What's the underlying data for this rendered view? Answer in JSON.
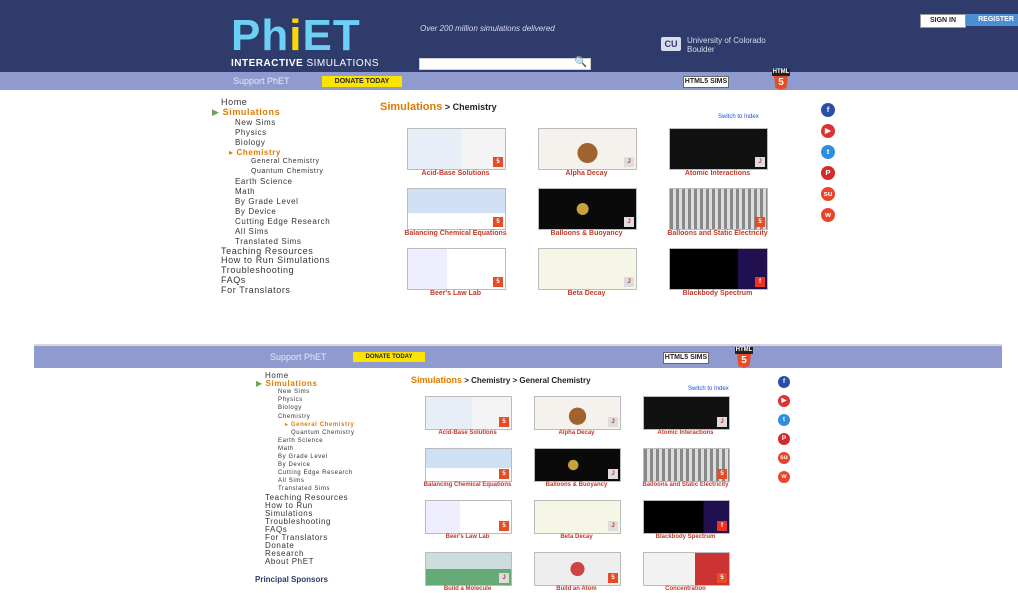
{
  "header": {
    "logo_main": [
      "Ph",
      "i",
      "ET"
    ],
    "logo_sub_bold": "INTERACTIVE",
    "logo_sub": " SIMULATIONS",
    "tagline": "Over 200 million simulations delivered",
    "university_line1": "University of Colorado",
    "university_line2": "Boulder",
    "university_mark": "CU",
    "signin": "SIGN IN",
    "register": "REGISTER",
    "search_icon": "search-icon",
    "search_glyph": "🔍"
  },
  "support_bar": {
    "support_text": "Support PhET",
    "donate": "DONATE TODAY",
    "html5_sims": "HTML5 SIMS",
    "html5_label": "HTML",
    "html5_glyph": "5"
  },
  "colors": {
    "header": "#2e3b6b",
    "support_bar": "#8f9bcf",
    "accent_orange": "#e07b00",
    "title_red": "#c0392b",
    "donate_yellow": "#fce300"
  },
  "top": {
    "nav": [
      {
        "label": "Home",
        "level": 0
      },
      {
        "label": "Simulations",
        "level": 0,
        "state": "active-arrow"
      },
      {
        "label": "New Sims",
        "level": 1
      },
      {
        "label": "Physics",
        "level": 1
      },
      {
        "label": "Biology",
        "level": 1
      },
      {
        "label": "Chemistry",
        "level": 1,
        "state": "active-bullet"
      },
      {
        "label": "General Chemistry",
        "level": 2
      },
      {
        "label": "Quantum Chemistry",
        "level": 2
      },
      {
        "label": "Earth Science",
        "level": 1
      },
      {
        "label": "Math",
        "level": 1
      },
      {
        "label": "By Grade Level",
        "level": 1
      },
      {
        "label": "By Device",
        "level": 1
      },
      {
        "label": "Cutting Edge Research",
        "level": 1
      },
      {
        "label": "All Sims",
        "level": 1
      },
      {
        "label": "Translated Sims",
        "level": 1
      },
      {
        "label": "Teaching Resources",
        "level": 0
      },
      {
        "label": "How to Run Simulations",
        "level": 0
      },
      {
        "label": "Troubleshooting",
        "level": 0
      },
      {
        "label": "FAQs",
        "level": 0
      },
      {
        "label": "For Translators",
        "level": 0
      }
    ],
    "breadcrumb": {
      "root": "Simulations",
      "sep": " > ",
      "leaf": "Chemistry"
    },
    "switch_link": "Switch to Index",
    "sims": [
      {
        "title": "Acid-Base Solutions",
        "badge": "html5"
      },
      {
        "title": "Alpha Decay",
        "badge": "java"
      },
      {
        "title": "Atomic Interactions",
        "badge": "java"
      },
      {
        "title": "Balancing Chemical Equations",
        "badge": "html5"
      },
      {
        "title": "Balloons & Buoyancy",
        "badge": "java"
      },
      {
        "title": "Balloons and Static Electricity",
        "badge": "html5"
      },
      {
        "title": "Beer's Law Lab",
        "badge": "html5"
      },
      {
        "title": "Beta Decay",
        "badge": "java"
      },
      {
        "title": "Blackbody Spectrum",
        "badge": "flash"
      }
    ]
  },
  "bottom": {
    "nav": [
      {
        "label": "Home",
        "level": 0
      },
      {
        "label": "Simulations",
        "level": 0,
        "state": "active-arrow"
      },
      {
        "label": "New Sims",
        "level": 1
      },
      {
        "label": "Physics",
        "level": 1
      },
      {
        "label": "Biology",
        "level": 1
      },
      {
        "label": "Chemistry",
        "level": 1
      },
      {
        "label": "General Chemistry",
        "level": 2,
        "state": "active-bullet"
      },
      {
        "label": "Quantum Chemistry",
        "level": 2
      },
      {
        "label": "Earth Science",
        "level": 1
      },
      {
        "label": "Math",
        "level": 1
      },
      {
        "label": "By Grade Level",
        "level": 1
      },
      {
        "label": "By Device",
        "level": 1
      },
      {
        "label": "Cutting Edge Research",
        "level": 1
      },
      {
        "label": "All Sims",
        "level": 1
      },
      {
        "label": "Translated Sims",
        "level": 1
      },
      {
        "label": "Teaching Resources",
        "level": 0
      },
      {
        "label": "How to Run",
        "level": 0
      },
      {
        "label": "Simulations",
        "level": 0
      },
      {
        "label": "Troubleshooting",
        "level": 0
      },
      {
        "label": "FAQs",
        "level": 0
      },
      {
        "label": "For Translators",
        "level": 0
      },
      {
        "label": "Donate",
        "level": 0
      },
      {
        "label": "Research",
        "level": 0
      },
      {
        "label": "About PhET",
        "level": 0
      }
    ],
    "sponsors": "Principal Sponsors",
    "breadcrumb": {
      "root": "Simulations",
      "sep": " > ",
      "mid": "Chemistry",
      "leaf": "General Chemistry"
    },
    "switch_link": "Switch to Index",
    "sims": [
      {
        "title": "Acid-Base Solutions",
        "badge": "html5"
      },
      {
        "title": "Alpha Decay",
        "badge": "java"
      },
      {
        "title": "Atomic Interactions",
        "badge": "java"
      },
      {
        "title": "Balancing Chemical Equations",
        "badge": "html5"
      },
      {
        "title": "Balloons & Buoyancy",
        "badge": "java"
      },
      {
        "title": "Balloons and Static Electricity",
        "badge": "html5"
      },
      {
        "title": "Beer's Law Lab",
        "badge": "html5"
      },
      {
        "title": "Beta Decay",
        "badge": "java"
      },
      {
        "title": "Blackbody Spectrum",
        "badge": "flash"
      },
      {
        "title": "Build a Molecule",
        "badge": "java"
      },
      {
        "title": "Build an Atom",
        "badge": "html5"
      },
      {
        "title": "Concentration",
        "badge": "html5"
      }
    ]
  },
  "social": [
    {
      "icon": "facebook-icon",
      "glyph": "f",
      "color": "#2b4fa8"
    },
    {
      "icon": "youtube-icon",
      "glyph": "▶",
      "color": "#e03131"
    },
    {
      "icon": "twitter-icon",
      "glyph": "t",
      "color": "#2f8fdc"
    },
    {
      "icon": "pinterest-icon",
      "glyph": "P",
      "color": "#d62a2a"
    },
    {
      "icon": "stumbleupon-icon",
      "glyph": "su",
      "color": "#e8452c"
    },
    {
      "icon": "weibo-icon",
      "glyph": "w",
      "color": "#e8452c"
    }
  ]
}
